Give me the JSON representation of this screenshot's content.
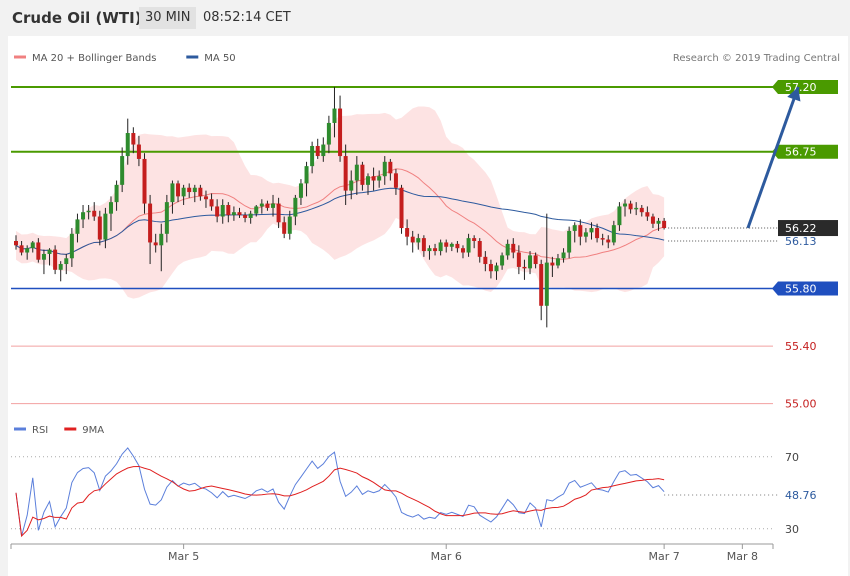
{
  "header": {
    "instrument": "Crude Oil (WTI)",
    "timeframe": "30 MIN",
    "clock": "08:52:14 CET"
  },
  "legend": {
    "items": [
      {
        "label": "MA 20 + Bollinger Bands",
        "color": "#f08080"
      },
      {
        "label": "MA 50",
        "color": "#2d5a9e"
      }
    ],
    "copyright": "Research © 2019 Trading Central"
  },
  "rsi_legend": {
    "items": [
      {
        "label": "RSI",
        "color": "#5b7fdb"
      },
      {
        "label": "9MA",
        "color": "#e02020"
      }
    ]
  },
  "colors": {
    "up": "#2e8b2e",
    "down": "#c41e1e",
    "resistance": "#4a9a00",
    "support": "#1f4fbf",
    "weak": "#f2a0a0",
    "arrow": "#2d5a9e"
  },
  "chart_data": [
    {
      "type": "candlestick",
      "ylim": [
        54.97,
        57.29
      ],
      "x_ticks": [
        "Mar 5",
        "Mar 6",
        "Mar 7",
        "Mar 8"
      ],
      "levels": [
        {
          "value": 57.2,
          "label": "57.20",
          "kind": "resistance"
        },
        {
          "value": 56.75,
          "label": "56.75",
          "kind": "resistance"
        },
        {
          "value": 55.8,
          "label": "55.80",
          "kind": "support"
        },
        {
          "value": 55.4,
          "label": "55.40",
          "kind": "weak"
        },
        {
          "value": 55.0,
          "label": "55.00",
          "kind": "weak"
        }
      ],
      "last_price": {
        "value": 56.22,
        "label": "56.22"
      },
      "ma50_value": {
        "value": 56.13,
        "label": "56.13"
      },
      "projection": {
        "from": [
          131,
          56.22
        ],
        "to": [
          140,
          57.2
        ]
      },
      "ohlc": [
        [
          56.13,
          56.17,
          56.07,
          56.1
        ],
        [
          56.1,
          56.13,
          56.03,
          56.05
        ],
        [
          56.05,
          56.1,
          56.0,
          56.08
        ],
        [
          56.08,
          56.13,
          56.05,
          56.12
        ],
        [
          56.12,
          56.15,
          55.98,
          56.0
        ],
        [
          56.0,
          56.07,
          55.9,
          56.04
        ],
        [
          56.04,
          56.08,
          55.96,
          56.07
        ],
        [
          56.07,
          56.1,
          55.9,
          55.93
        ],
        [
          55.93,
          55.99,
          55.85,
          55.97
        ],
        [
          55.97,
          56.04,
          55.9,
          56.01
        ],
        [
          56.01,
          56.22,
          55.95,
          56.18
        ],
        [
          56.18,
          56.32,
          56.12,
          56.28
        ],
        [
          56.28,
          56.38,
          56.22,
          56.33
        ],
        [
          56.33,
          56.38,
          56.28,
          56.34
        ],
        [
          56.34,
          56.4,
          56.27,
          56.3
        ],
        [
          56.3,
          56.34,
          56.1,
          56.14
        ],
        [
          56.14,
          56.36,
          56.08,
          56.32
        ],
        [
          56.32,
          56.44,
          56.2,
          56.4
        ],
        [
          56.4,
          56.55,
          56.34,
          56.52
        ],
        [
          56.52,
          56.78,
          56.47,
          56.72
        ],
        [
          56.72,
          56.98,
          56.66,
          56.88
        ],
        [
          56.88,
          56.92,
          56.74,
          56.8
        ],
        [
          56.8,
          56.86,
          56.65,
          56.7
        ],
        [
          56.7,
          56.74,
          56.32,
          56.39
        ],
        [
          56.39,
          56.45,
          55.97,
          56.12
        ],
        [
          56.12,
          56.18,
          56.05,
          56.1
        ],
        [
          56.1,
          56.25,
          55.92,
          56.18
        ],
        [
          56.18,
          56.45,
          56.12,
          56.4
        ],
        [
          56.4,
          56.55,
          56.32,
          56.53
        ],
        [
          56.53,
          56.55,
          56.4,
          56.44
        ],
        [
          56.44,
          56.52,
          56.38,
          56.5
        ],
        [
          56.5,
          56.53,
          56.43,
          56.47
        ],
        [
          56.47,
          56.52,
          56.4,
          56.5
        ],
        [
          56.5,
          56.52,
          56.41,
          56.44
        ],
        [
          56.44,
          56.48,
          56.36,
          56.42
        ],
        [
          56.42,
          56.46,
          56.34,
          56.37
        ],
        [
          56.37,
          56.42,
          56.26,
          56.3
        ],
        [
          56.3,
          56.42,
          56.25,
          56.38
        ],
        [
          56.38,
          56.4,
          56.26,
          56.31
        ],
        [
          56.31,
          56.37,
          56.27,
          56.33
        ],
        [
          56.33,
          56.36,
          56.29,
          56.31
        ],
        [
          56.31,
          56.33,
          56.26,
          56.29
        ],
        [
          56.29,
          56.34,
          56.25,
          56.32
        ],
        [
          56.32,
          56.38,
          56.3,
          56.37
        ],
        [
          56.37,
          56.42,
          56.32,
          56.39
        ],
        [
          56.39,
          56.41,
          56.34,
          56.36
        ],
        [
          56.36,
          56.45,
          56.3,
          56.39
        ],
        [
          56.39,
          56.43,
          56.22,
          56.26
        ],
        [
          56.26,
          56.3,
          56.15,
          56.18
        ],
        [
          56.18,
          56.34,
          56.14,
          56.3
        ],
        [
          56.3,
          56.45,
          56.24,
          56.43
        ],
        [
          56.43,
          56.56,
          56.38,
          56.53
        ],
        [
          56.53,
          56.68,
          56.44,
          56.65
        ],
        [
          56.65,
          56.82,
          56.6,
          56.79
        ],
        [
          56.79,
          56.84,
          56.7,
          56.72
        ],
        [
          56.72,
          56.85,
          56.68,
          56.8
        ],
        [
          56.8,
          57.0,
          56.74,
          56.95
        ],
        [
          56.95,
          57.2,
          56.85,
          57.05
        ],
        [
          57.05,
          57.14,
          56.68,
          56.72
        ],
        [
          56.72,
          56.8,
          56.38,
          56.48
        ],
        [
          56.48,
          56.62,
          56.42,
          56.55
        ],
        [
          56.55,
          56.72,
          56.45,
          56.66
        ],
        [
          56.66,
          56.68,
          56.48,
          56.52
        ],
        [
          56.52,
          56.6,
          56.45,
          56.58
        ],
        [
          56.58,
          56.64,
          56.48,
          56.55
        ],
        [
          56.55,
          56.62,
          56.5,
          56.58
        ],
        [
          56.58,
          56.72,
          56.52,
          56.68
        ],
        [
          56.68,
          56.7,
          56.55,
          56.6
        ],
        [
          56.6,
          56.63,
          56.45,
          56.5
        ],
        [
          56.5,
          56.52,
          56.18,
          56.22
        ],
        [
          56.22,
          56.28,
          56.1,
          56.16
        ],
        [
          56.16,
          56.2,
          56.05,
          56.12
        ],
        [
          56.12,
          56.18,
          56.07,
          56.15
        ],
        [
          56.15,
          56.17,
          56.02,
          56.06
        ],
        [
          56.06,
          56.1,
          56.0,
          56.08
        ],
        [
          56.08,
          56.11,
          56.03,
          56.06
        ],
        [
          56.06,
          56.14,
          56.03,
          56.12
        ],
        [
          56.12,
          56.14,
          56.05,
          56.09
        ],
        [
          56.09,
          56.12,
          56.06,
          56.11
        ],
        [
          56.11,
          56.13,
          56.05,
          56.08
        ],
        [
          56.08,
          56.1,
          56.01,
          56.05
        ],
        [
          56.05,
          56.18,
          56.02,
          56.15
        ],
        [
          56.15,
          56.17,
          56.08,
          56.13
        ],
        [
          56.13,
          56.15,
          55.98,
          56.02
        ],
        [
          56.02,
          56.06,
          55.92,
          55.97
        ],
        [
          55.97,
          56.0,
          55.87,
          55.92
        ],
        [
          55.92,
          55.98,
          55.86,
          55.96
        ],
        [
          55.96,
          56.05,
          55.93,
          56.03
        ],
        [
          56.03,
          56.14,
          56.0,
          56.11
        ],
        [
          56.11,
          56.15,
          56.01,
          56.05
        ],
        [
          56.05,
          56.1,
          55.9,
          55.95
        ],
        [
          55.95,
          56.0,
          55.86,
          55.94
        ],
        [
          55.94,
          56.06,
          55.9,
          56.03
        ],
        [
          56.03,
          56.05,
          55.94,
          55.97
        ],
        [
          55.97,
          56.0,
          55.58,
          55.68
        ],
        [
          55.68,
          56.32,
          55.53,
          55.98
        ],
        [
          55.98,
          56.02,
          55.88,
          55.96
        ],
        [
          55.96,
          56.04,
          55.94,
          56.01
        ],
        [
          56.01,
          56.08,
          55.98,
          56.05
        ],
        [
          56.05,
          56.23,
          56.01,
          56.2
        ],
        [
          56.2,
          56.26,
          56.12,
          56.24
        ],
        [
          56.24,
          56.28,
          56.1,
          56.16
        ],
        [
          56.16,
          56.22,
          56.12,
          56.19
        ],
        [
          56.19,
          56.26,
          56.14,
          56.22
        ],
        [
          56.22,
          56.25,
          56.12,
          56.15
        ],
        [
          56.15,
          56.18,
          56.1,
          56.14
        ],
        [
          56.14,
          56.17,
          56.08,
          56.12
        ],
        [
          56.12,
          56.27,
          56.1,
          56.24
        ],
        [
          56.24,
          56.4,
          56.2,
          56.37
        ],
        [
          56.37,
          56.42,
          56.3,
          56.39
        ],
        [
          56.39,
          56.41,
          56.32,
          56.35
        ],
        [
          56.35,
          56.4,
          56.31,
          56.36
        ],
        [
          56.36,
          56.38,
          56.3,
          56.33
        ],
        [
          56.33,
          56.37,
          56.27,
          56.3
        ],
        [
          56.3,
          56.32,
          56.22,
          56.25
        ],
        [
          56.25,
          56.29,
          56.2,
          56.27
        ],
        [
          56.27,
          56.29,
          56.21,
          56.22
        ]
      ]
    },
    {
      "type": "line",
      "name": "RSI",
      "ylim": [
        26,
        76
      ],
      "y_ticks": [
        30,
        70
      ],
      "current_value": {
        "value": 48.76,
        "label": "48.76"
      }
    }
  ]
}
